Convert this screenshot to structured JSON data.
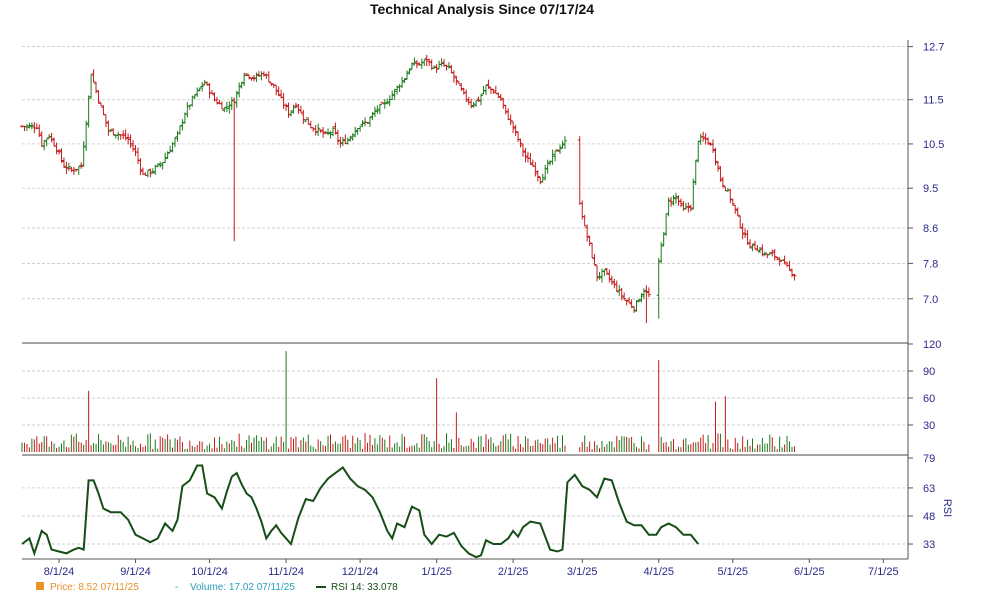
{
  "chart_data": {
    "type": "stock-chart",
    "title": "Technical Analysis Since 07/17/24",
    "colors": {
      "up": "#1e7a1e",
      "down": "#c41a1a",
      "grid": "#bdbdbd",
      "axis": "#2a2a8a",
      "rsi": "#174d17",
      "price_legend": "#e8902a",
      "volume_legend": "#2aa0b8"
    },
    "x_axis": {
      "ticks": [
        {
          "day": 15,
          "label": "8/1/24"
        },
        {
          "day": 46,
          "label": "9/1/24"
        },
        {
          "day": 76,
          "label": "10/1/24"
        },
        {
          "day": 107,
          "label": "11/1/24"
        },
        {
          "day": 137,
          "label": "12/1/24"
        },
        {
          "day": 168,
          "label": "1/1/25"
        },
        {
          "day": 199,
          "label": "2/1/25"
        },
        {
          "day": 227,
          "label": "3/1/25"
        },
        {
          "day": 258,
          "label": "4/1/25"
        },
        {
          "day": 288,
          "label": "5/1/25"
        },
        {
          "day": 319,
          "label": "6/1/25"
        },
        {
          "day": 349,
          "label": "7/1/25"
        }
      ],
      "range": [
        0,
        359
      ]
    },
    "price": {
      "ylim": [
        6.0,
        12.85
      ],
      "ticks": [
        "12.7",
        "11.5",
        "10.5",
        "9.5",
        "8.6",
        "7.8",
        "7.0"
      ],
      "tick_values": [
        12.7,
        11.5,
        10.5,
        9.5,
        8.6,
        7.8,
        7.0
      ],
      "anchors": [
        [
          0,
          10.9
        ],
        [
          6,
          10.9
        ],
        [
          8,
          10.5
        ],
        [
          11,
          10.7
        ],
        [
          14,
          10.4
        ],
        [
          17,
          10.0
        ],
        [
          20,
          9.9
        ],
        [
          24,
          10.0
        ],
        [
          26,
          11.0
        ],
        [
          28,
          12.1
        ],
        [
          31,
          11.5
        ],
        [
          35,
          10.8
        ],
        [
          40,
          10.7
        ],
        [
          43,
          10.6
        ],
        [
          46,
          10.3
        ],
        [
          49,
          9.8
        ],
        [
          53,
          9.9
        ],
        [
          57,
          10.1
        ],
        [
          60,
          10.4
        ],
        [
          63,
          10.7
        ],
        [
          66,
          11.2
        ],
        [
          70,
          11.6
        ],
        [
          74,
          11.9
        ],
        [
          78,
          11.5
        ],
        [
          82,
          11.3
        ],
        [
          86,
          11.5
        ],
        [
          90,
          12.1
        ],
        [
          94,
          12.0
        ],
        [
          98,
          12.1
        ],
        [
          102,
          11.8
        ],
        [
          105,
          11.5
        ],
        [
          108,
          11.2
        ],
        [
          111,
          11.4
        ],
        [
          114,
          11.1
        ],
        [
          117,
          10.9
        ],
        [
          120,
          10.8
        ],
        [
          123,
          10.7
        ],
        [
          126,
          10.8
        ],
        [
          129,
          10.5
        ],
        [
          132,
          10.6
        ],
        [
          136,
          10.9
        ],
        [
          140,
          11.0
        ],
        [
          144,
          11.3
        ],
        [
          147,
          11.4
        ],
        [
          151,
          11.7
        ],
        [
          155,
          12.0
        ],
        [
          158,
          12.3
        ],
        [
          161,
          12.3
        ],
        [
          164,
          12.4
        ],
        [
          167,
          12.2
        ],
        [
          170,
          12.3
        ],
        [
          173,
          12.2
        ],
        [
          176,
          11.9
        ],
        [
          179,
          11.6
        ],
        [
          182,
          11.4
        ],
        [
          185,
          11.5
        ],
        [
          188,
          11.8
        ],
        [
          191,
          11.7
        ],
        [
          194,
          11.5
        ],
        [
          196,
          11.2
        ],
        [
          198,
          11.0
        ],
        [
          201,
          10.6
        ],
        [
          204,
          10.2
        ],
        [
          207,
          10.0
        ],
        [
          210,
          9.7
        ],
        [
          213,
          10.0
        ],
        [
          216,
          10.3
        ],
        [
          219,
          10.5
        ],
        [
          222,
          10.6
        ],
        [
          224,
          10.0
        ],
        [
          226,
          9.2
        ],
        [
          228,
          8.6
        ],
        [
          230,
          8.2
        ],
        [
          233,
          7.5
        ],
        [
          236,
          7.6
        ],
        [
          240,
          7.3
        ],
        [
          244,
          7.0
        ],
        [
          248,
          6.8
        ],
        [
          252,
          7.2
        ],
        [
          256,
          6.95
        ],
        [
          259,
          8.2
        ],
        [
          262,
          9.2
        ],
        [
          265,
          9.3
        ],
        [
          268,
          9.0
        ],
        [
          271,
          9.1
        ],
        [
          274,
          10.6
        ],
        [
          277,
          10.6
        ],
        [
          280,
          10.4
        ],
        [
          283,
          9.7
        ],
        [
          286,
          9.4
        ],
        [
          289,
          9.0
        ],
        [
          292,
          8.5
        ],
        [
          295,
          8.2
        ],
        [
          298,
          8.15
        ],
        [
          301,
          8.0
        ],
        [
          304,
          8.0
        ],
        [
          307,
          7.9
        ],
        [
          310,
          7.7
        ],
        [
          313,
          7.55
        ]
      ],
      "gaps": [
        [
          220,
          226
        ],
        [
          254,
          258
        ]
      ],
      "spikes": [
        [
          86,
          8.3
        ],
        [
          253,
          6.45
        ],
        [
          258,
          6.55
        ]
      ]
    },
    "volume": {
      "ylim": [
        0,
        120
      ],
      "ticks": [
        "120",
        "90",
        "60",
        "30"
      ],
      "tick_values": [
        120,
        90,
        60,
        30
      ],
      "spikes": [
        [
          27,
          68
        ],
        [
          107,
          112
        ],
        [
          168,
          82
        ],
        [
          258,
          102
        ],
        [
          281,
          56
        ],
        [
          285,
          62
        ],
        [
          176,
          44
        ]
      ]
    },
    "rsi": {
      "ylim": [
        25,
        79
      ],
      "ticks": [
        "79",
        "63",
        "48",
        "33"
      ],
      "tick_values": [
        79,
        63,
        48,
        33
      ],
      "label": "RSI",
      "anchors": [
        [
          0,
          33
        ],
        [
          3,
          36
        ],
        [
          5,
          28
        ],
        [
          8,
          40
        ],
        [
          10,
          38
        ],
        [
          12,
          30
        ],
        [
          15,
          29
        ],
        [
          18,
          28
        ],
        [
          21,
          30
        ],
        [
          23,
          31
        ],
        [
          25,
          30
        ],
        [
          27,
          67
        ],
        [
          29,
          67
        ],
        [
          31,
          60
        ],
        [
          33,
          52
        ],
        [
          36,
          50
        ],
        [
          40,
          50
        ],
        [
          43,
          46
        ],
        [
          46,
          38
        ],
        [
          49,
          36
        ],
        [
          52,
          34
        ],
        [
          55,
          36
        ],
        [
          58,
          44
        ],
        [
          61,
          40
        ],
        [
          63,
          46
        ],
        [
          65,
          64
        ],
        [
          68,
          67
        ],
        [
          71,
          75
        ],
        [
          73,
          75
        ],
        [
          75,
          60
        ],
        [
          78,
          58
        ],
        [
          81,
          52
        ],
        [
          83,
          61
        ],
        [
          85,
          69
        ],
        [
          87,
          71
        ],
        [
          89,
          65
        ],
        [
          91,
          60
        ],
        [
          93,
          58
        ],
        [
          95,
          52
        ],
        [
          97,
          45
        ],
        [
          99,
          36
        ],
        [
          101,
          40
        ],
        [
          103,
          43
        ],
        [
          105,
          39
        ],
        [
          107,
          36
        ],
        [
          109,
          33
        ],
        [
          112,
          47
        ],
        [
          115,
          57
        ],
        [
          118,
          56
        ],
        [
          121,
          63
        ],
        [
          124,
          68
        ],
        [
          127,
          71
        ],
        [
          130,
          74
        ],
        [
          133,
          68
        ],
        [
          136,
          64
        ],
        [
          139,
          62
        ],
        [
          142,
          58
        ],
        [
          145,
          50
        ],
        [
          148,
          40
        ],
        [
          150,
          36
        ],
        [
          152,
          44
        ],
        [
          155,
          42
        ],
        [
          158,
          53
        ],
        [
          161,
          51
        ],
        [
          163,
          38
        ],
        [
          166,
          33
        ],
        [
          169,
          38
        ],
        [
          172,
          37
        ],
        [
          175,
          39
        ],
        [
          178,
          32
        ],
        [
          181,
          28
        ],
        [
          184,
          26
        ],
        [
          186,
          27
        ],
        [
          188,
          35
        ],
        [
          191,
          33
        ],
        [
          194,
          33
        ],
        [
          197,
          36
        ],
        [
          199,
          40
        ],
        [
          201,
          37
        ],
        [
          203,
          42
        ],
        [
          206,
          45
        ],
        [
          210,
          44
        ],
        [
          214,
          30
        ],
        [
          217,
          29
        ],
        [
          219,
          30
        ],
        [
          221,
          66
        ],
        [
          224,
          70
        ],
        [
          227,
          64
        ],
        [
          230,
          62
        ],
        [
          233,
          58
        ],
        [
          236,
          68
        ],
        [
          239,
          67
        ],
        [
          242,
          55
        ],
        [
          245,
          45
        ],
        [
          248,
          43
        ],
        [
          251,
          43
        ],
        [
          254,
          38
        ],
        [
          257,
          38
        ],
        [
          259,
          42
        ],
        [
          262,
          44
        ],
        [
          265,
          42
        ],
        [
          268,
          38
        ],
        [
          271,
          38
        ],
        [
          274,
          33
        ]
      ]
    },
    "legend": [
      {
        "key": "price",
        "text": "Price: 8.52  07/11/25"
      },
      {
        "key": "volume",
        "text": "Volume: 17.02  07/11/25"
      },
      {
        "key": "rsi",
        "text": "RSI 14: 33.078"
      }
    ]
  }
}
